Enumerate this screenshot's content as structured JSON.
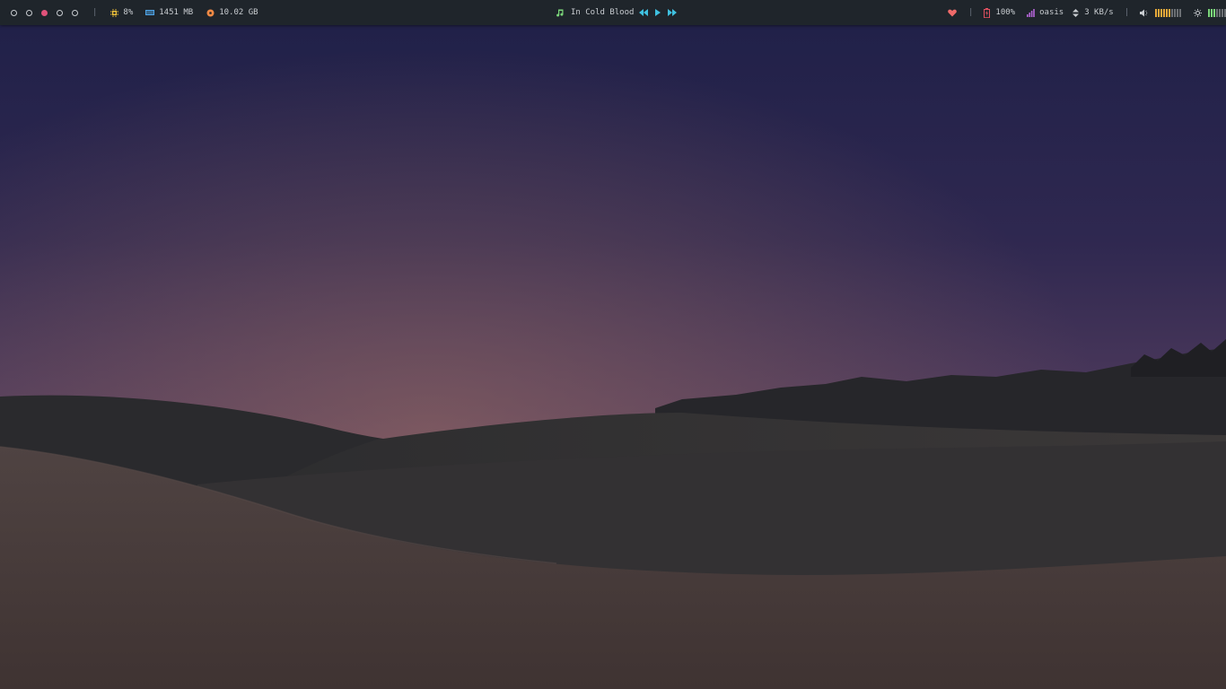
{
  "workspaces": [
    {
      "state": "empty"
    },
    {
      "state": "empty"
    },
    {
      "state": "active"
    },
    {
      "state": "empty"
    },
    {
      "state": "empty"
    }
  ],
  "separator": "|",
  "system": {
    "cpu": "8%",
    "memory": "1451 MB",
    "disk": "10.02 GB"
  },
  "music": {
    "track": "In Cold Blood"
  },
  "battery": "100%",
  "network": {
    "ssid": "oasis",
    "speed": "3 KB/s"
  },
  "volume_level": 0.6,
  "brightness_level": 0.3,
  "colors": {
    "bar_bg": "#1f252b",
    "text": "#c8ccd0",
    "accent_pink": "#e0527a",
    "cpu_yellow": "#f4c53a",
    "mem_blue": "#4ea3e6",
    "disk_orange": "#f08a45",
    "music_green": "#7bd67a",
    "media_cyan": "#3fc1e0",
    "heart_red": "#f06a6a",
    "battery_red": "#e05060",
    "wifi_purple": "#b565d8",
    "volume_orange": "#e7a83a",
    "brightness_green": "#7bd67a"
  },
  "icons": {
    "cpu": "cpu-icon",
    "memory": "memory-icon",
    "disk": "disk-icon",
    "music": "music-note-icon",
    "prev": "rewind-icon",
    "play": "play-icon",
    "next": "fast-forward-icon",
    "heart": "heart-icon",
    "battery": "battery-icon",
    "signal": "signal-icon",
    "transfer": "up-down-arrows-icon",
    "volume": "speaker-icon",
    "brightness": "sun-icon"
  }
}
